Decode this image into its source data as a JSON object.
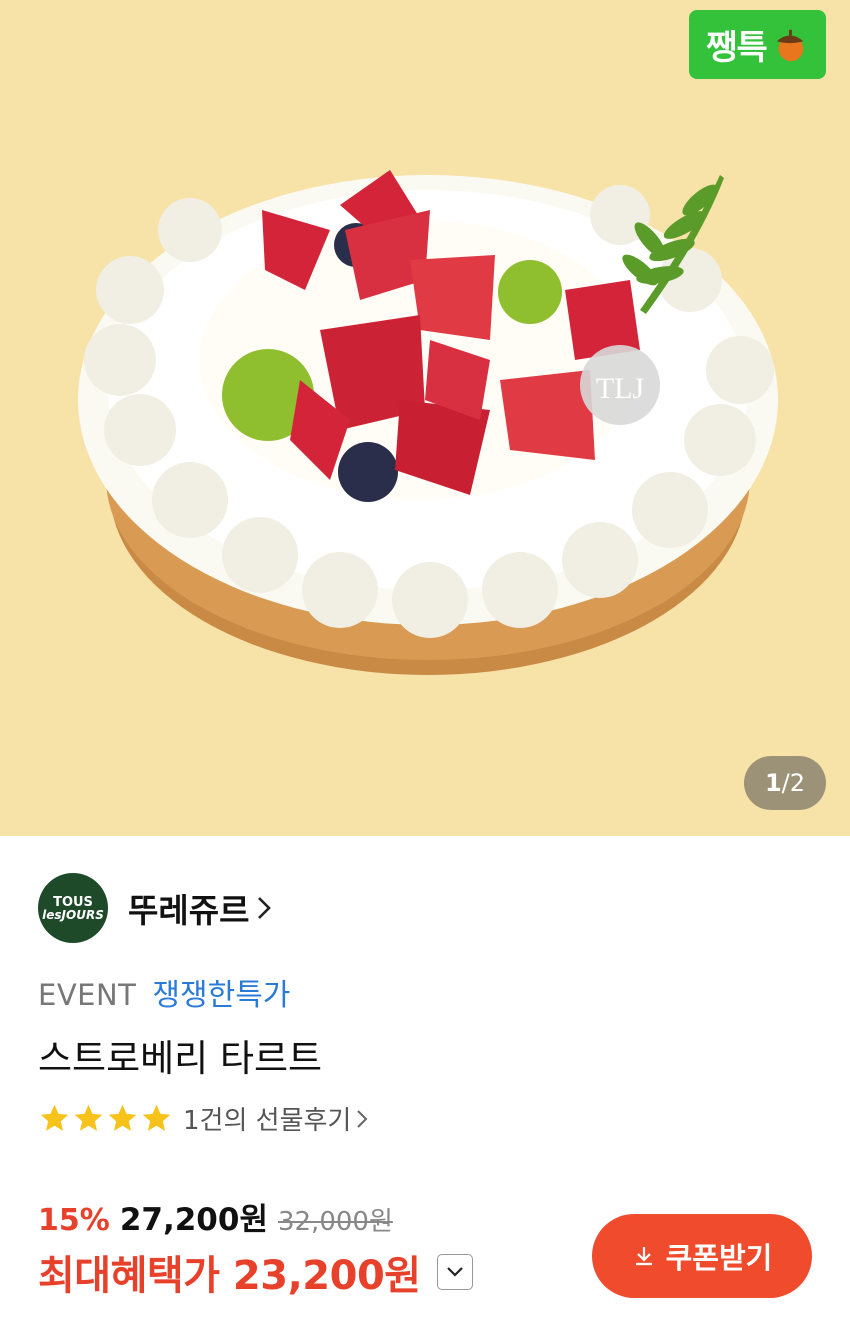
{
  "hero": {
    "badge_label": "쨍특",
    "page_current": "1",
    "page_total": "/2",
    "image_icon": "strawberry-tart-image"
  },
  "brand": {
    "logo_line1": "TOUS",
    "logo_line2": "lesJOURS",
    "name": "뚜레쥬르"
  },
  "event": {
    "label": "EVENT",
    "name": "쟁쟁한특가"
  },
  "product": {
    "title": "스트로베리 타르트"
  },
  "rating": {
    "stars": 4,
    "review_text": "1건의 선물후기"
  },
  "price": {
    "discount": "15%",
    "price": "27,200원",
    "original": "32,000원",
    "max_benefit_label": "최대혜택가 23,200원"
  },
  "coupon": {
    "label": "쿠폰받기"
  },
  "colors": {
    "accent": "#e8412b",
    "badge": "#33c23a",
    "event": "#2a7bd6",
    "star": "#f7c21a"
  }
}
